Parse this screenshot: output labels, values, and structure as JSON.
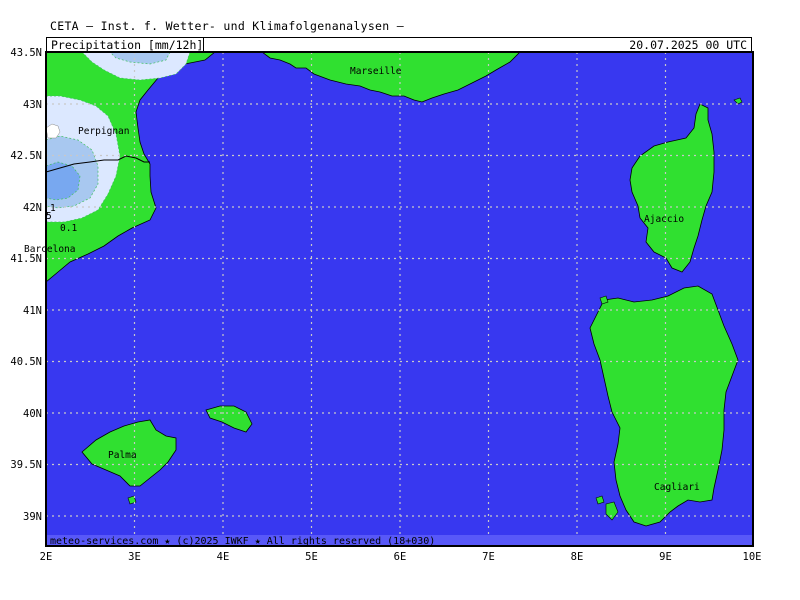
{
  "header": {
    "title": "CETA — Inst. f. Wetter- und Klimafolgenanalysen —",
    "variable": "Precipitation [mm/12h]",
    "valid_time": "20.07.2025 00 UTC"
  },
  "axes": {
    "lat_labels": [
      "43.5N",
      "43N",
      "42.5N",
      "42N",
      "41.5N",
      "41N",
      "40.5N",
      "40N",
      "39.5N",
      "39N"
    ],
    "lon_labels": [
      "2E",
      "3E",
      "4E",
      "5E",
      "6E",
      "7E",
      "8E",
      "9E",
      "10E"
    ]
  },
  "cities": [
    {
      "name": "Marseille"
    },
    {
      "name": "Perpignan"
    },
    {
      "name": "Barcelona"
    },
    {
      "name": "Ajaccio"
    },
    {
      "name": "Palma"
    },
    {
      "name": "Cagliari"
    }
  ],
  "contour_labels": [
    "1",
    "5",
    "0.1"
  ],
  "footer": {
    "text": "meteo-services.com ★ (c)2025 IWKF ★ All rights reserved (18+030)"
  },
  "colors": {
    "sea": "#3838f0",
    "land": "#30e030",
    "precip_light": "#dce8ff",
    "precip_mid": "#a8c8f0",
    "precip_heavy": "#78a8f0",
    "grid": "#c8c8c8",
    "footer_bar": "#5858f8"
  }
}
